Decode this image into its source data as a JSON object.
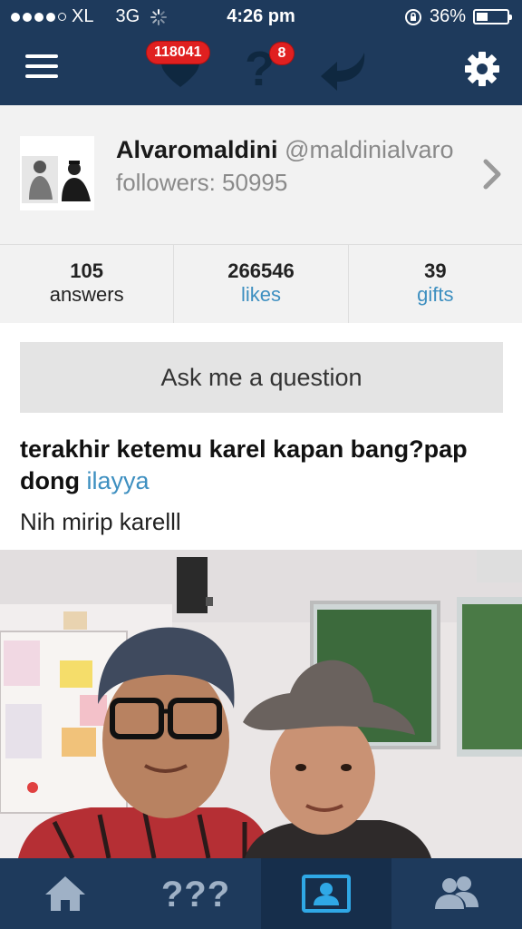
{
  "status_bar": {
    "carrier": "XL",
    "network": "3G",
    "time": "4:26 pm",
    "battery": "36%",
    "battery_level": 0.36
  },
  "nav": {
    "likes_badge": "118041",
    "questions_badge": "8",
    "icons": [
      "menu-icon",
      "heart-icon",
      "question-icon",
      "reply-icon",
      "gear-icon"
    ]
  },
  "profile": {
    "name": "Alvaromaldini",
    "handle": "@maldinialvaro",
    "followers": "followers: 50995"
  },
  "stats": [
    {
      "value": "105",
      "label": "answers"
    },
    {
      "value": "266546",
      "label": "likes"
    },
    {
      "value": "39",
      "label": "gifts"
    }
  ],
  "ask_button": "Ask me a question",
  "post": {
    "question": "terakhir ketemu karel kapan bang?pap dong",
    "asker": "ilayya",
    "answer": "Nih mirip karelll"
  },
  "tabs": [
    {
      "name": "home",
      "icon": "home-icon"
    },
    {
      "name": "questions",
      "icon": "questions-icon",
      "text": "???"
    },
    {
      "name": "profile",
      "icon": "profile-icon"
    },
    {
      "name": "friends",
      "icon": "friends-icon"
    }
  ],
  "colors": {
    "bar": "#1e3a5c",
    "accent": "#3d8fc0",
    "badge": "#e02020"
  }
}
